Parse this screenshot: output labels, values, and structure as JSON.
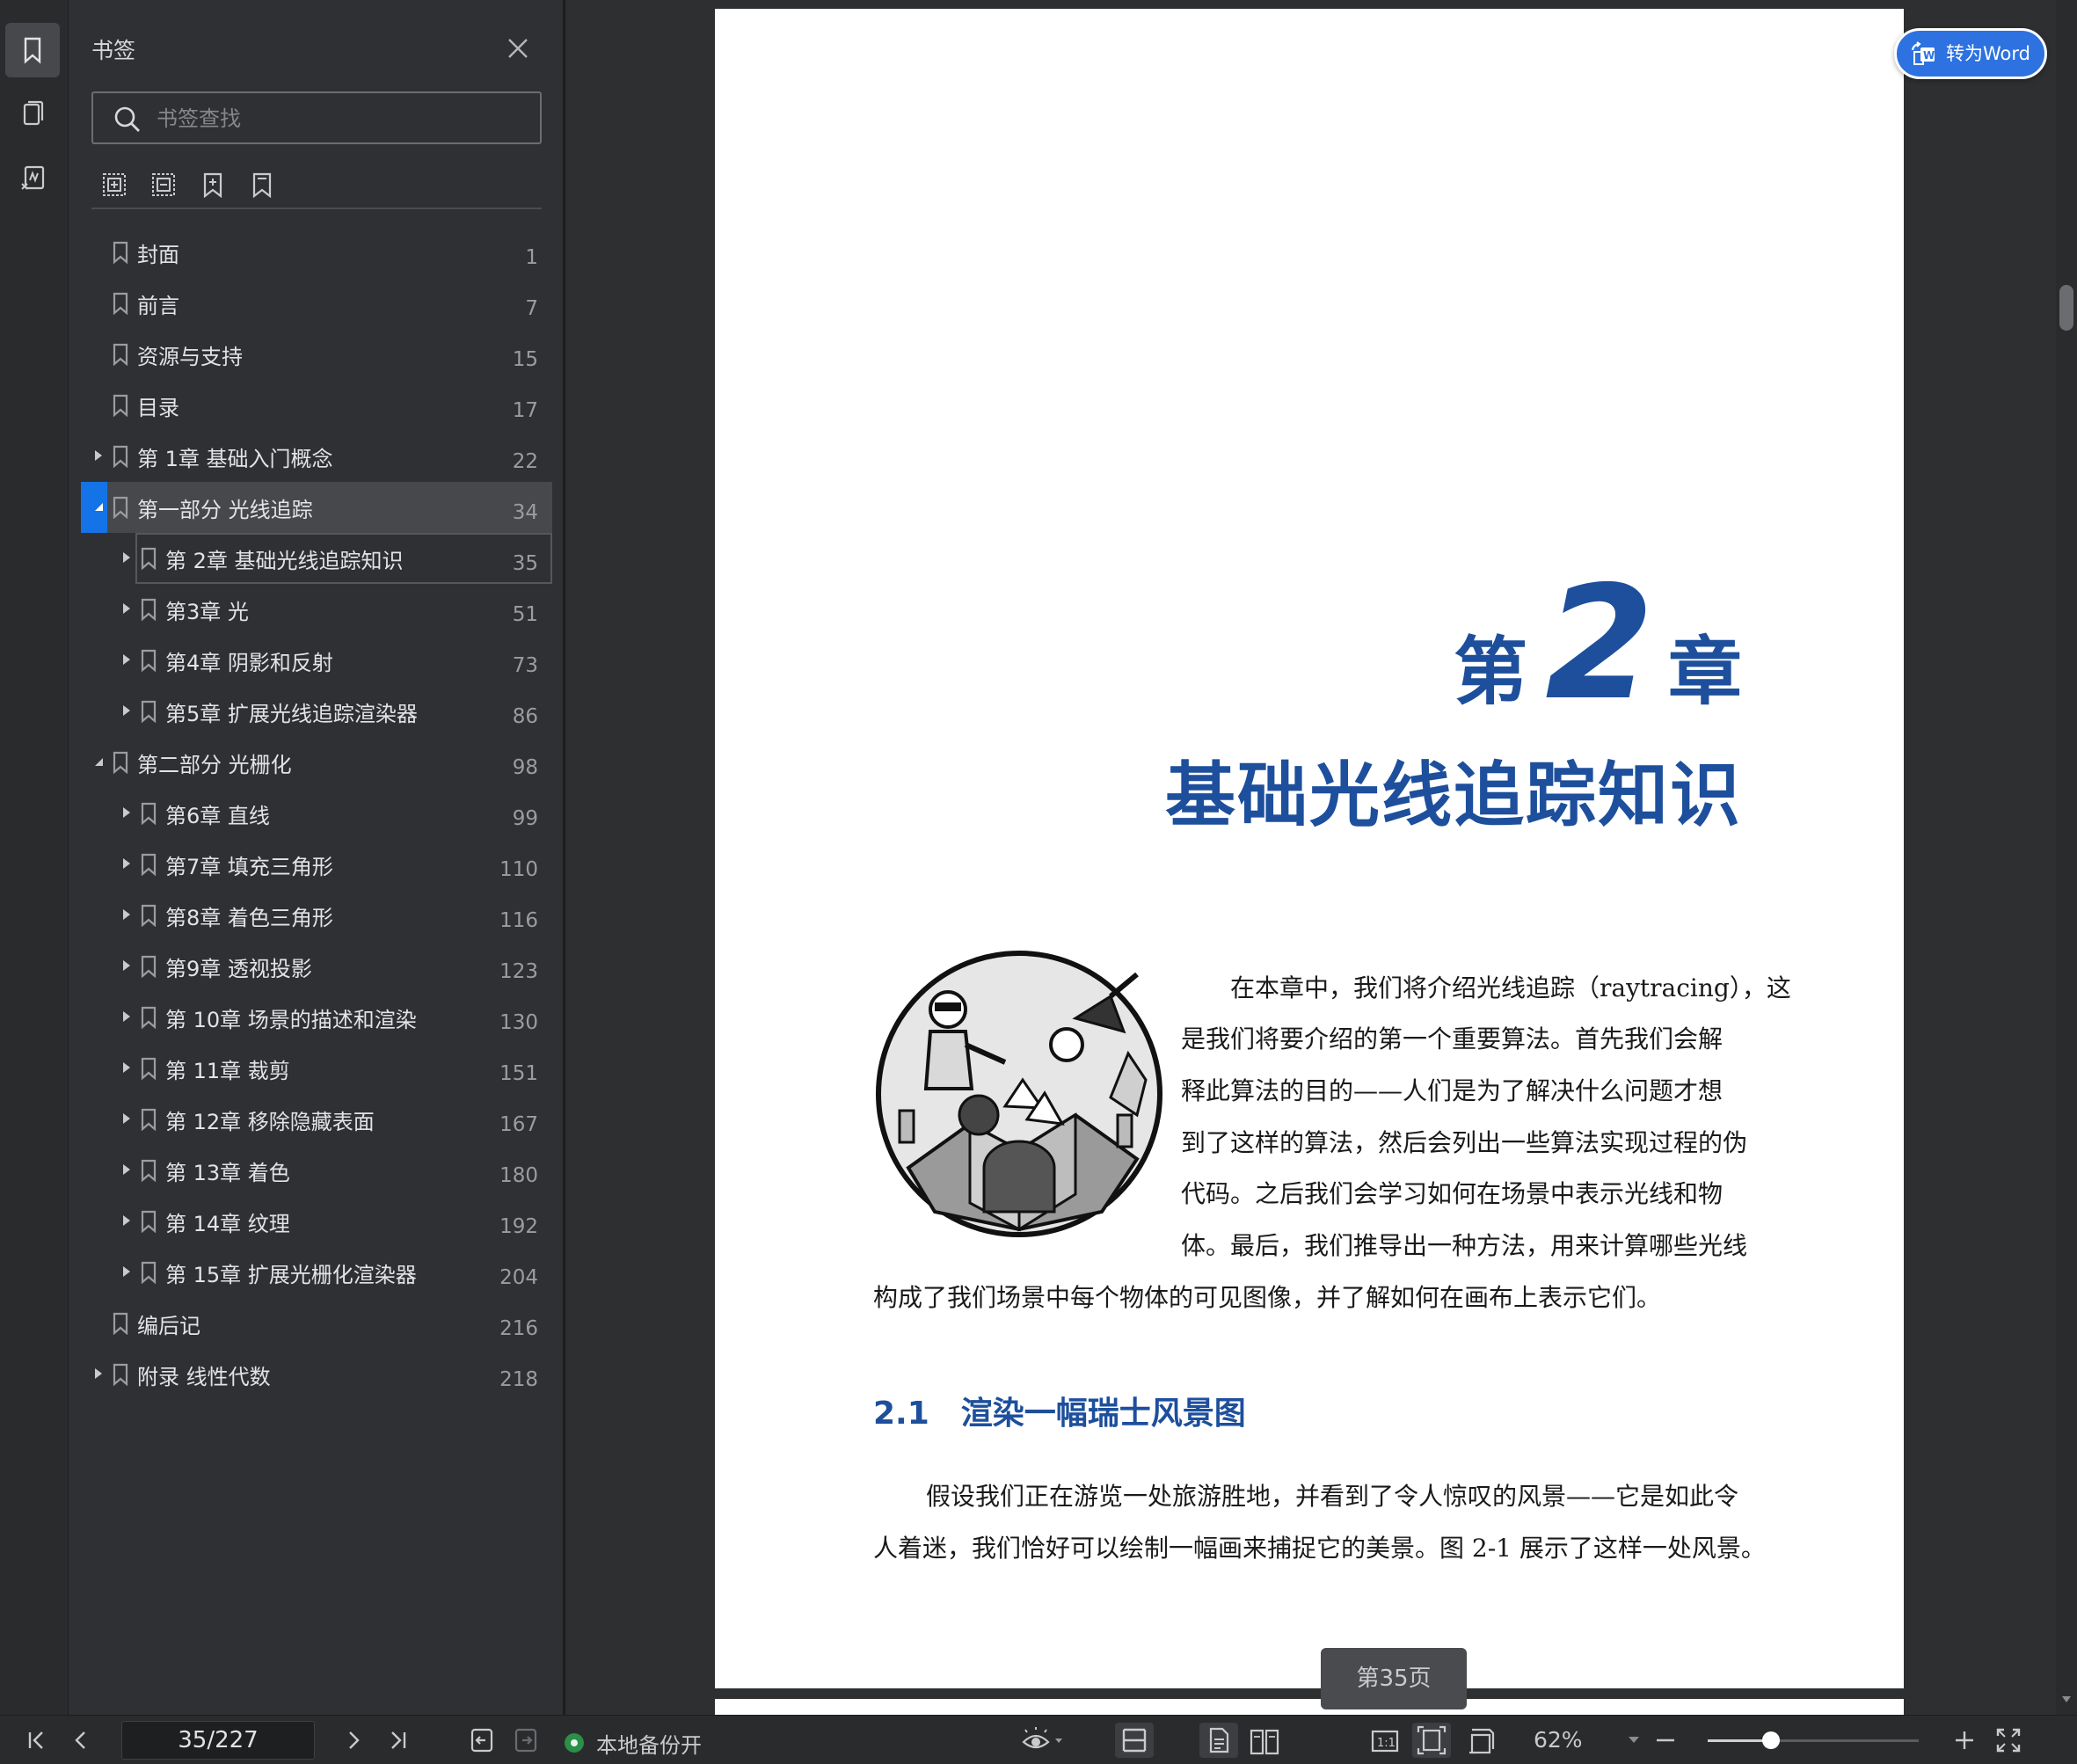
{
  "panel": {
    "title": "书签",
    "search_placeholder": "书签查找"
  },
  "bookmarks": [
    {
      "label": "封面",
      "page": "1"
    },
    {
      "label": "前言",
      "page": "7"
    },
    {
      "label": "资源与支持",
      "page": "15"
    },
    {
      "label": "目录",
      "page": "17"
    },
    {
      "label": "第 1章 基础入门概念",
      "page": "22"
    },
    {
      "label": "第一部分 光线追踪",
      "page": "34"
    },
    {
      "label": "第 2章 基础光线追踪知识",
      "page": "35"
    },
    {
      "label": "第3章 光",
      "page": "51"
    },
    {
      "label": "第4章 阴影和反射",
      "page": "73"
    },
    {
      "label": "第5章 扩展光线追踪渲染器",
      "page": "86"
    },
    {
      "label": "第二部分 光栅化",
      "page": "98"
    },
    {
      "label": "第6章 直线",
      "page": "99"
    },
    {
      "label": "第7章 填充三角形",
      "page": "110"
    },
    {
      "label": "第8章 着色三角形",
      "page": "116"
    },
    {
      "label": "第9章 透视投影",
      "page": "123"
    },
    {
      "label": "第 10章 场景的描述和渲染",
      "page": "130"
    },
    {
      "label": "第 11章 裁剪",
      "page": "151"
    },
    {
      "label": "第 12章 移除隐藏表面",
      "page": "167"
    },
    {
      "label": "第 13章 着色",
      "page": "180"
    },
    {
      "label": "第 14章 纹理",
      "page": "192"
    },
    {
      "label": "第 15章 扩展光栅化渲染器",
      "page": "204"
    },
    {
      "label": "编后记",
      "page": "216"
    },
    {
      "label": "附录 线性代数",
      "page": "218"
    }
  ],
  "document": {
    "chapter_prefix": "第",
    "chapter_number": "2",
    "chapter_suffix": "章",
    "chapter_title": "基础光线追踪知识",
    "intro_lines": [
      "在本章中，我们将介绍光线追踪（raytracing），这",
      "是我们将要介绍的第一个重要算法。首先我们会解",
      "释此算法的目的——人们是为了解决什么问题才想",
      "到了这样的算法，然后会列出一些算法实现过程的伪",
      "代码。之后我们会学习如何在场景中表示光线和物",
      "体。最后，我们推导出一种方法，用来计算哪些光线",
      "构成了我们场景中每个物体的可见图像，并了解如何在画布上表示它们。"
    ],
    "section_number": "2.1",
    "section_title": "渲染一幅瑞士风景图",
    "section_lines": [
      "假设我们正在游览一处旅游胜地，并看到了令人惊叹的风景——它是如此令",
      "人着迷，我们恰好可以绘制一幅画来捕捉它的美景。图 2-1 展示了这样一处风景。"
    ],
    "page_badge": "第35页"
  },
  "to_word": "转为Word",
  "bottombar": {
    "page_value": "35/227",
    "backup_label": "本地备份开",
    "zoom_label": "62%",
    "zoom_level": 0.3
  }
}
